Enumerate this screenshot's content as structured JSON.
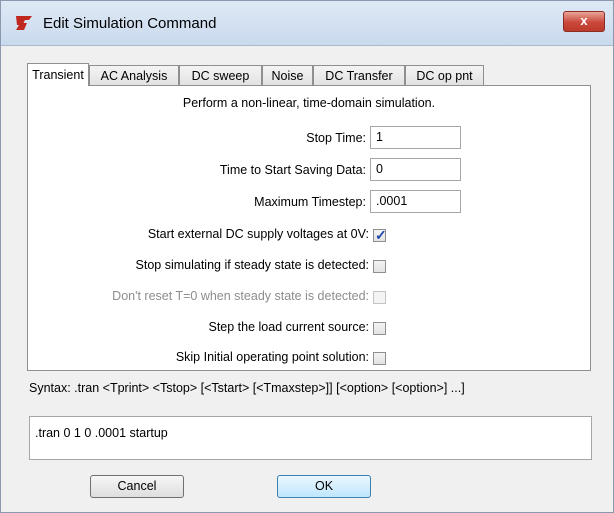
{
  "window": {
    "title": "Edit Simulation Command",
    "close_label": "x"
  },
  "tabs": [
    {
      "label": "Transient",
      "active": true
    },
    {
      "label": "AC Analysis"
    },
    {
      "label": "DC sweep"
    },
    {
      "label": "Noise"
    },
    {
      "label": "DC Transfer"
    },
    {
      "label": "DC op pnt"
    }
  ],
  "transient": {
    "description": "Perform a non-linear, time-domain simulation.",
    "stop_time": {
      "label": "Stop Time:",
      "value": "1"
    },
    "start_saving": {
      "label": "Time to Start Saving Data:",
      "value": "0"
    },
    "max_timestep": {
      "label": "Maximum Timestep:",
      "value": ".0001"
    },
    "options": [
      {
        "label": "Start external DC supply voltages at 0V:",
        "checked": true,
        "disabled": false
      },
      {
        "label": "Stop simulating if steady state is detected:",
        "checked": false,
        "disabled": false
      },
      {
        "label": "Don't reset T=0 when steady state is detected:",
        "checked": false,
        "disabled": true
      },
      {
        "label": "Step the load current source:",
        "checked": false,
        "disabled": false
      },
      {
        "label": "Skip Initial operating point solution:",
        "checked": false,
        "disabled": false
      }
    ]
  },
  "syntax": "Syntax:  .tran <Tprint> <Tstop> [<Tstart> [<Tmaxstep>]] [<option> [<option>] ...]",
  "command": ".tran 0 1 0 .0001 startup",
  "buttons": {
    "cancel": "Cancel",
    "ok": "OK"
  },
  "colors": {
    "titlebar": "#c9daee",
    "close": "#c9483a",
    "check": "#2147a8",
    "ok_button": "#bee6fd"
  }
}
